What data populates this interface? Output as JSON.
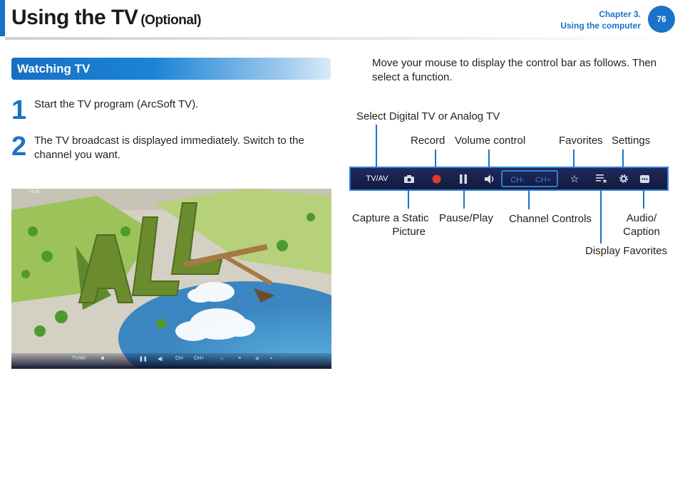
{
  "header": {
    "title": "Using the TV",
    "subtitle": "(Optional)",
    "chapter": "Chapter 3.",
    "chapter_name": "Using the computer",
    "page_number": "76"
  },
  "section": {
    "title": "Watching TV"
  },
  "steps": [
    {
      "number": "1",
      "text": "Start the TV program (ArcSoft TV)."
    },
    {
      "number": "2",
      "text": "The TV broadcast is displayed immediately. Switch to the channel you want."
    }
  ],
  "screenshot": {
    "app_label": "TV Sc",
    "controls": {
      "tvav": "TV/AV",
      "ch_minus": "CH-",
      "ch_plus": "CH+"
    }
  },
  "intro": "Move your mouse to display the control bar as follows. Then select a function.",
  "control_bar": {
    "tvav": "TV/AV",
    "ch_minus": "CH-",
    "ch_plus": "CH+",
    "accent_color": "#1a73c8"
  },
  "labels": {
    "select_tv": "Select Digital TV or Analog TV",
    "record": "Record",
    "volume": "Volume control",
    "favorites": "Favorites",
    "settings": "Settings",
    "capture_line1": "Capture a Static",
    "capture_line2": "Picture",
    "pause_play": "Pause/Play",
    "channel_controls": "Channel Controls",
    "audio_line1": "Audio/",
    "audio_line2": "Caption",
    "display_favorites": "Display Favorites"
  }
}
